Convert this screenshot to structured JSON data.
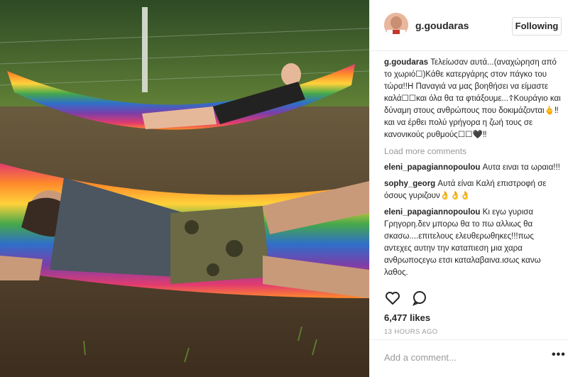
{
  "post": {
    "username": "g.goudaras",
    "follow_label": "Following",
    "caption_user": "g.goudaras",
    "caption_text": "Τελείωσαν αυτά...(αναχώρηση από το χωριό☐)Κάθε κατεργάρης στον πάγκο του τώρα!!Η Παναγιά να μας βοηθήσει να είμαστε καλά☐☐και όλα θα τα φτιάξουμε...☦Κουράγιο και δύναμη στους ανθρώπους που δοκιμάζονται🖕‼ και να έρθει πολύ γρήγορα η ζωή τους σε κανονικούς ρυθμούς☐☐🖤‼",
    "load_more": "Load more comments",
    "comments": [
      {
        "user": "eleni_papagiannopoulou",
        "text": "Αυτα ειναι τα ωραια!!!"
      },
      {
        "user": "sophy_georg",
        "text": "Αυτά είναι Καλή επιστροφή σε όσους γυριζουν👌👌👌"
      },
      {
        "user": "eleni_papagiannopoulou",
        "text": "Κι εγω γυρισα Γρηγορη.δεν μπορω θα το πω αλλιως θα σκασω....επιτελους ελευθερωθηκες!!!πως αντεχες αυτην την καταπιεση μια χαρα ανθρωποςεγω ετσι καταλαβαινα.ισως κανω λαθος."
      }
    ],
    "likes": "6,477 likes",
    "time": "13 HOURS AGO",
    "add_comment_placeholder": "Add a comment...",
    "more_label": "•••"
  },
  "icons": {
    "like": "heart-icon",
    "comment": "comment-icon"
  }
}
